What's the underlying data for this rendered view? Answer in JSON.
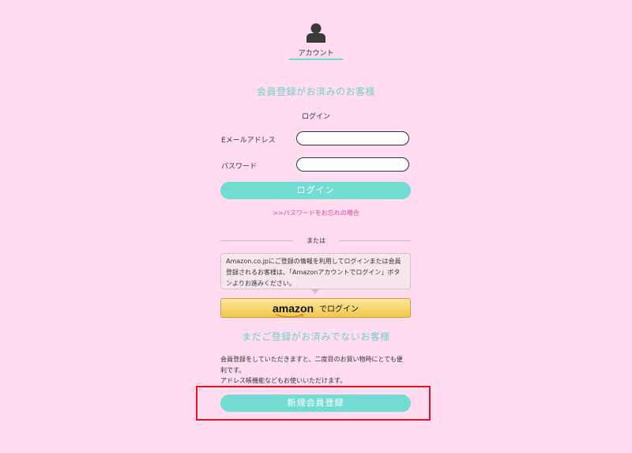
{
  "header": {
    "account_label": "アカウント"
  },
  "member_section": {
    "title": "会員登録がお済みのお客様",
    "login_heading": "ログイン",
    "email_label": "Eメールアドレス",
    "email_value": "",
    "password_label": "パスワード",
    "password_value": "",
    "login_button": "ログイン",
    "forgot_link": ">>パスワードをお忘れの場合",
    "or_text": "または"
  },
  "amazon": {
    "info_text": "Amazon.co.jpにご登録の情報を利用してログインまたは会員登録されるお客様は、「Amazonアカウントでログイン」ボタンよりお進みください。",
    "wordmark": "amazon",
    "login_text": "でログイン"
  },
  "new_member": {
    "title": "まだご登録がお済みでないお客様",
    "desc_line1": "会員登録をしていただきますと、二度目のお買い物時にとても便",
    "desc_line2": "利です。",
    "desc_line3": "アドレス帳機能などもお使いいただけます。",
    "register_button": "新規会員登録"
  },
  "colors": {
    "background": "#ffdcef",
    "accent": "#74ddd2",
    "link": "#e8449e",
    "highlight": "#e8101e",
    "amazon_button": "#f2c84c"
  }
}
